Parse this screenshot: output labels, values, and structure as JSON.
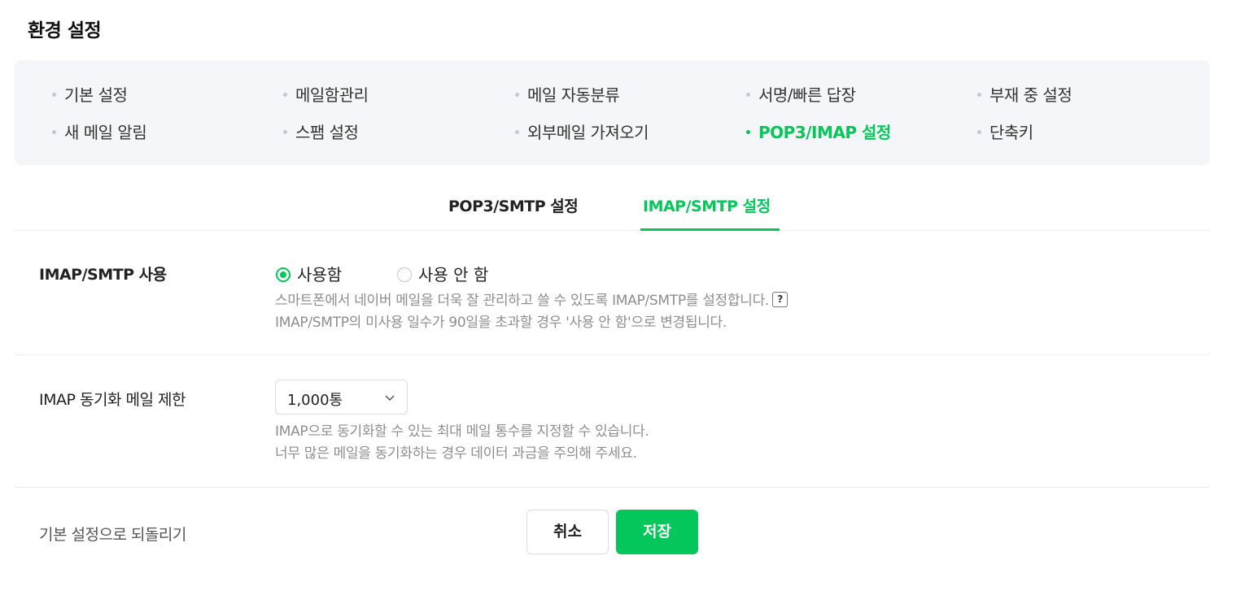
{
  "page": {
    "title": "환경 설정"
  },
  "menu": {
    "items": [
      {
        "label": "기본 설정",
        "active": false
      },
      {
        "label": "메일함관리",
        "active": false
      },
      {
        "label": "메일 자동분류",
        "active": false
      },
      {
        "label": "서명/빠른 답장",
        "active": false
      },
      {
        "label": "부재 중 설정",
        "active": false
      },
      {
        "label": "새 메일 알림",
        "active": false
      },
      {
        "label": "스팸 설정",
        "active": false
      },
      {
        "label": "외부메일 가져오기",
        "active": false
      },
      {
        "label": "POP3/IMAP 설정",
        "active": true
      },
      {
        "label": "단축키",
        "active": false
      }
    ]
  },
  "tabs": [
    {
      "label": "POP3/SMTP 설정",
      "active": false
    },
    {
      "label": "IMAP/SMTP 설정",
      "active": true
    }
  ],
  "imap_usage": {
    "label": "IMAP/SMTP 사용",
    "options": [
      {
        "label": "사용함",
        "checked": true
      },
      {
        "label": "사용 안 함",
        "checked": false
      }
    ],
    "desc_line1": "스마트폰에서 네이버 메일을 더욱 잘 관리하고 쓸 수 있도록 IMAP/SMTP를 설정합니다.",
    "help_icon": "?",
    "desc_line2": "IMAP/SMTP의 미사용 일수가 90일을 초과할 경우 '사용 안 함'으로 변경됩니다."
  },
  "sync_limit": {
    "label": "IMAP 동기화 메일 제한",
    "selected": "1,000통",
    "desc_line1": "IMAP으로 동기화할 수 있는 최대 메일 통수를 지정할 수 있습니다.",
    "desc_line2": "너무 많은 메일을 동기화하는 경우 데이터 과금을 주의해 주세요."
  },
  "footer": {
    "reset_label": "기본 설정으로 되돌리기",
    "cancel_label": "취소",
    "save_label": "저장"
  },
  "colors": {
    "accent": "#03c75a",
    "menu_bg": "#f4f6fa",
    "muted_text": "#8e8e8e"
  }
}
